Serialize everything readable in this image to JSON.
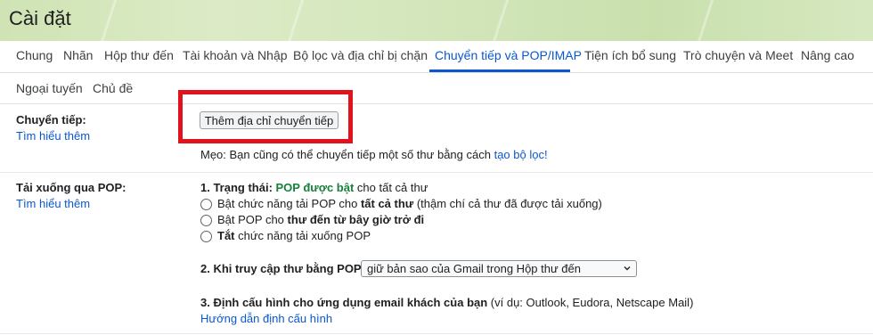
{
  "header": {
    "title": "Cài đặt"
  },
  "tabs": [
    {
      "label": "Chung"
    },
    {
      "label": "Nhãn"
    },
    {
      "label": "Hộp thư đến"
    },
    {
      "label": "Tài khoản và Nhập"
    },
    {
      "label": "Bộ lọc và địa chỉ bị chặn"
    },
    {
      "label": "Chuyển tiếp và POP/IMAP",
      "active": true
    },
    {
      "label": "Tiện ích bổ sung"
    },
    {
      "label": "Trò chuyện và Meet"
    },
    {
      "label": "Nâng cao"
    },
    {
      "label": "Ngoại tuyến"
    },
    {
      "label": "Chủ đề"
    }
  ],
  "forwarding": {
    "label": "Chuyển tiếp:",
    "learn_more": "Tìm hiểu thêm",
    "add_button": "Thêm địa chỉ chuyển tiếp",
    "tip_text": "Mẹo: Bạn cũng có thể chuyển tiếp một số thư bằng cách ",
    "tip_link": "tạo bộ lọc!"
  },
  "pop": {
    "label": "Tải xuống qua POP:",
    "learn_more": "Tìm hiểu thêm",
    "status_prefix": "1. Trạng thái: ",
    "status_value": "POP được bật",
    "status_suffix": " cho tất cả thư",
    "options": [
      {
        "pre": "Bật chức năng tải POP cho ",
        "bold": "tất cả thư",
        "post": " (thậm chí cả thư đã được tải xuống)"
      },
      {
        "pre": "Bật POP cho ",
        "bold": "thư đến từ bây giờ trở đi",
        "post": ""
      },
      {
        "pre": "",
        "bold": "Tắt",
        "post": " chức năng tải xuống POP"
      }
    ],
    "access_label": "2. Khi truy cập thư bằng POP",
    "access_select": "giữ bản sao của Gmail trong Hộp thư đến",
    "config_label": "3. Định cấu hình cho ứng dụng email khách của bạn",
    "config_example": " (ví dụ: Outlook, Eudora, Netscape Mail)",
    "config_link": "Hướng dẫn định cấu hình"
  },
  "colors": {
    "accent": "#0b57d0",
    "highlight": "#e1121b",
    "status_green": "#188038"
  },
  "icons": {
    "select_arrow": "chevron-down-icon"
  }
}
